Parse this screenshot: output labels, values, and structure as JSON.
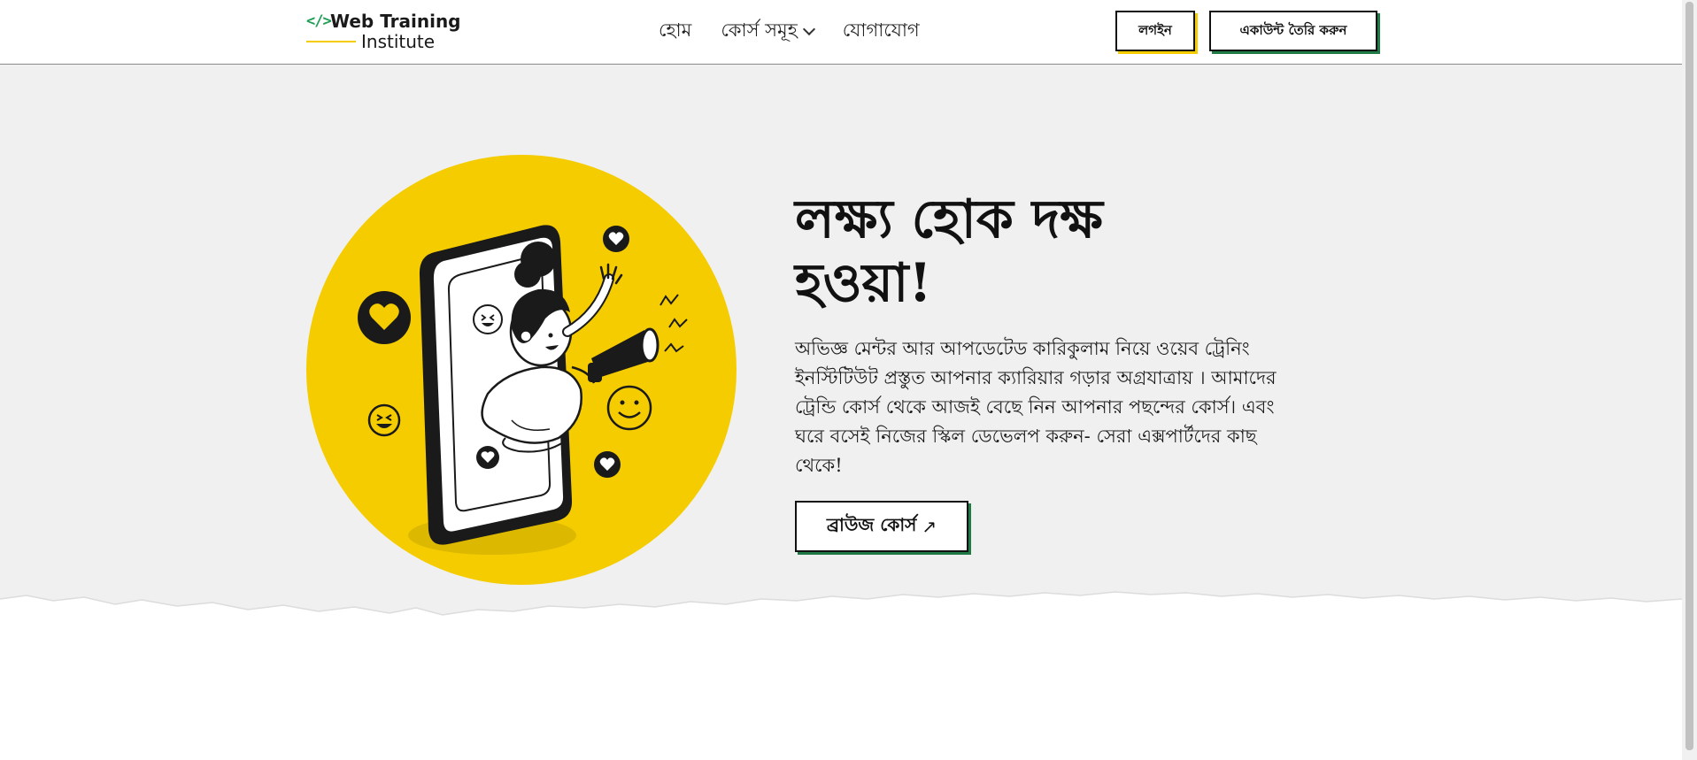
{
  "logo": {
    "icon": "</>",
    "line1": "Web Training",
    "line2": "Institute",
    "icon_name": "code-brackets-icon"
  },
  "nav": {
    "items": [
      {
        "label": "হোম",
        "active": true
      },
      {
        "label": "কোর্স সমূহ",
        "has_dropdown": true
      },
      {
        "label": "যোগাযোগ"
      }
    ]
  },
  "header_buttons": {
    "login": "লগইন",
    "signup": "একাউন্ট তৈরি করুন"
  },
  "hero": {
    "title": "লক্ষ্য হোক দক্ষ হওয়া!",
    "description": "অভিজ্ঞ মেন্টর আর আপডেটেড কারিকুলাম নিয়ে ওয়েব ট্রেনিং ইনস্টিটিউট প্রস্তুত আপনার ক্যারিয়ার গড়ার অগ্রযাত্রায় । আমাদের ট্রেন্ডি কোর্স থেকে আজই বেছে নিন আপনার পছন্দের কোর্স। এবং ঘরে বসেই নিজের স্কিল ডেভেলপ করুন- সেরা এক্সপার্টদের কাছ থেকে!",
    "browse_button": "ব্রাউজ কোর্স",
    "browse_icon": "↗"
  },
  "colors": {
    "accent_yellow": "#f4cc00",
    "accent_green": "#1f7a46",
    "hero_bg": "#f0f0f0"
  }
}
